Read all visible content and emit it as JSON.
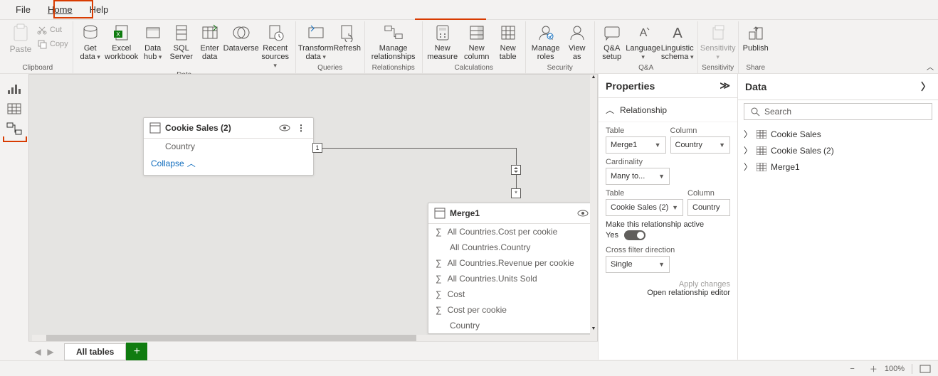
{
  "menu": {
    "file": "File",
    "home": "Home",
    "help": "Help"
  },
  "ribbon": {
    "clipboard": {
      "paste": "Paste",
      "cut": "Cut",
      "copy": "Copy",
      "group": "Clipboard"
    },
    "data": {
      "get_data": "Get data",
      "excel": "Excel workbook",
      "data_hub": "Data hub",
      "sql": "SQL Server",
      "enter": "Enter data",
      "dataverse": "Dataverse",
      "recent": "Recent sources",
      "group": "Data"
    },
    "queries": {
      "transform": "Transform data",
      "refresh": "Refresh",
      "group": "Queries"
    },
    "relationships": {
      "manage": "Manage relationships",
      "group": "Relationships"
    },
    "calculations": {
      "new_measure": "New measure",
      "new_column": "New column",
      "new_table": "New table",
      "group": "Calculations"
    },
    "security": {
      "manage_roles": "Manage roles",
      "view_as": "View as",
      "group": "Security"
    },
    "qa": {
      "qa_setup": "Q&A setup",
      "language": "Language",
      "linguistic": "Linguistic schema",
      "group": "Q&A"
    },
    "sensitivity": {
      "label": "Sensitivity",
      "group": "Sensitivity"
    },
    "share": {
      "publish": "Publish",
      "group": "Share"
    }
  },
  "model": {
    "table1": {
      "name": "Cookie Sales (2)",
      "fields": [
        "Country"
      ],
      "collapse": "Collapse"
    },
    "table2": {
      "name": "Merge1",
      "fields": [
        "All Countries.Cost per cookie",
        "All Countries.Country",
        "All Countries.Revenue per cookie",
        "All Countries.Units Sold",
        "Cost",
        "Cost per cookie",
        "Country"
      ]
    },
    "rel_card_one": "1",
    "rel_card_many": "*"
  },
  "tabs": {
    "all_tables": "All tables"
  },
  "properties": {
    "title": "Properties",
    "section": "Relationship",
    "table_label": "Table",
    "column_label": "Column",
    "table1_value": "Merge1",
    "column1_value": "Country",
    "cardinality_label": "Cardinality",
    "cardinality_value": "Many to...",
    "table2_value": "Cookie Sales (2)",
    "column2_value": "Country",
    "active_label": "Make this relationship active",
    "active_value": "Yes",
    "cross_filter_label": "Cross filter direction",
    "cross_filter_value": "Single",
    "apply_changes": "Apply changes",
    "open_editor": "Open relationship editor"
  },
  "data_panel": {
    "title": "Data",
    "search_placeholder": "Search",
    "tables": [
      "Cookie Sales",
      "Cookie Sales (2)",
      "Merge1"
    ]
  },
  "status": {
    "zoom": "100%"
  }
}
